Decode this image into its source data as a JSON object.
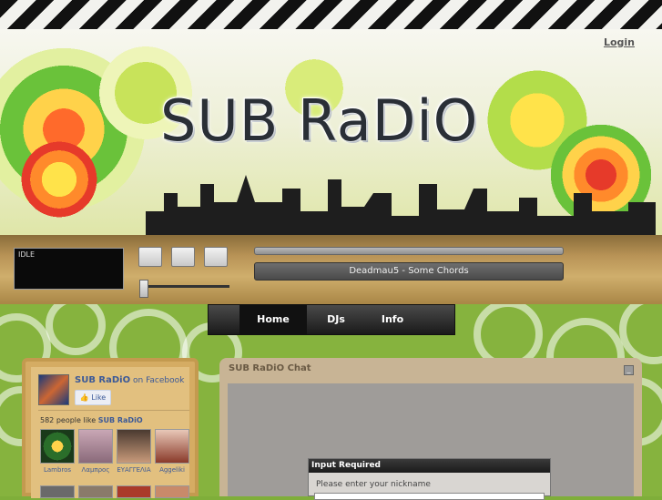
{
  "header": {
    "login_label": "Login",
    "site_title": "SUB RaDiO"
  },
  "player": {
    "status": "IDLE",
    "now_playing": "Deadmau5 - Some Chords",
    "buttons": [
      "play-icon",
      "stop-icon",
      "mute-icon"
    ]
  },
  "nav": {
    "items": [
      {
        "label": "Home"
      },
      {
        "label": "DJs"
      },
      {
        "label": "Info"
      }
    ]
  },
  "facebook": {
    "page_name": "SUB RaDiO",
    "on_text": "on Facebook",
    "like_label": "Like",
    "count_prefix": "582 people like",
    "count_name": "SUB RaDiO",
    "fans": [
      {
        "name": "Lambros"
      },
      {
        "name": "Λαμπρος"
      },
      {
        "name": "ΕΥΑΓΓΕΛΙΑ"
      },
      {
        "name": "Aggeliki"
      }
    ]
  },
  "chat": {
    "title": "SUB RaDiO Chat",
    "minimize_label": "_"
  },
  "dialog": {
    "title": "Input Required",
    "message": "Please enter your nickname"
  },
  "colors": {
    "facebook_blue": "#3b5998",
    "nav_bg": "#1a1a1a",
    "player_bg": "#b89356",
    "body_green": "#86b33e"
  }
}
